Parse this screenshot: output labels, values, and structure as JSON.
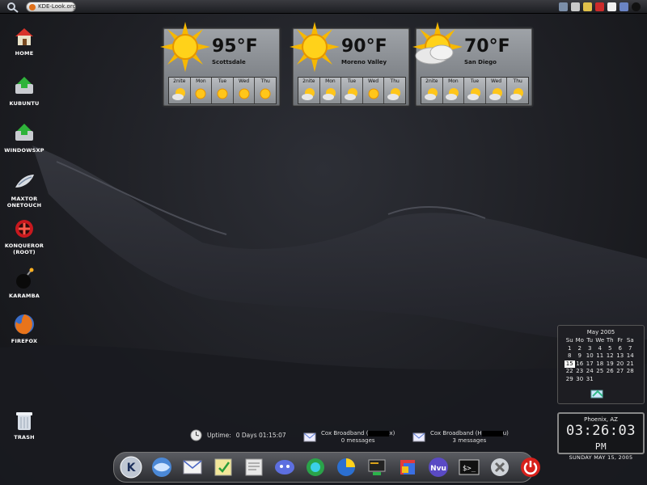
{
  "top_panel": {
    "tab_label": "KDE-Look.org",
    "tray_icons": [
      "network-icon",
      "printer-icon",
      "kmail-icon",
      "flag-icon",
      "eyes-icon",
      "mixer-icon",
      "bomb-icon"
    ]
  },
  "desktop_icons": [
    {
      "label": "HOME",
      "icon": "home-icon"
    },
    {
      "label": "KUBUNTU",
      "icon": "drive-icon"
    },
    {
      "label": "WINDOWSXP",
      "icon": "drive-icon"
    },
    {
      "label": "MAXTOR ONETOUCH",
      "icon": "usb-drive-icon"
    },
    {
      "label": "KONQUEROR (ROOT)",
      "icon": "konqueror-root-icon"
    },
    {
      "label": "KARAMBA",
      "icon": "bomb-icon"
    },
    {
      "label": "FIREFOX",
      "icon": "firefox-icon"
    },
    {
      "label": "TRASH",
      "icon": "trash-icon"
    }
  ],
  "weather": [
    {
      "temp": "95°F",
      "city": "Scottsdale",
      "icon": "sun-icon",
      "days": [
        "2nite",
        "Mon",
        "Tue",
        "Wed",
        "Thu"
      ]
    },
    {
      "temp": "90°F",
      "city": "Moreno Valley",
      "icon": "sun-icon",
      "days": [
        "2nite",
        "Mon",
        "Tue",
        "Wed",
        "Thu"
      ]
    },
    {
      "temp": "70°F",
      "city": "San Diego",
      "icon": "partly-cloudy-icon",
      "days": [
        "2nite",
        "Mon",
        "Tue",
        "Wed",
        "Thu"
      ]
    }
  ],
  "calendar": {
    "title": "May 2005",
    "weekdays": [
      "Su",
      "Mo",
      "Tu",
      "We",
      "Th",
      "Fr",
      "Sa"
    ],
    "days": [
      "1",
      "2",
      "3",
      "4",
      "5",
      "6",
      "7",
      "8",
      "9",
      "10",
      "11",
      "12",
      "13",
      "14",
      "15",
      "16",
      "17",
      "18",
      "19",
      "20",
      "21",
      "22",
      "23",
      "24",
      "25",
      "26",
      "27",
      "28",
      "29",
      "30",
      "31"
    ],
    "first_weekday_index": 0,
    "today": "15"
  },
  "clock": {
    "city": "Phoenix, AZ",
    "time": "03:26:03",
    "ampm": "PM",
    "date": "SUNDAY MAY 15, 2005"
  },
  "uptime": {
    "label": "Uptime:",
    "value": "0 Days 01:15:07"
  },
  "mail": [
    {
      "account_prefix": "Cox Broadband (",
      "account_suffix": "x)",
      "messages": "0 messages"
    },
    {
      "account_prefix": "Cox Broadband (H",
      "account_suffix": "u)",
      "messages": "3 messages"
    }
  ],
  "dock": [
    "kde-menu-icon",
    "konqueror-icon",
    "kmail-icon",
    "knotes-icon",
    "kate-icon",
    "kopete-icon",
    "skype-icon",
    "kcontrol-icon",
    "konsole-icon",
    "nvu-icon",
    "terminal-icon",
    "tools-icon",
    "shutdown-icon"
  ],
  "colors": {
    "desktop_bg": "#1e1f24",
    "widget_grey": "#8b8f93",
    "sun": "#f7b800"
  }
}
